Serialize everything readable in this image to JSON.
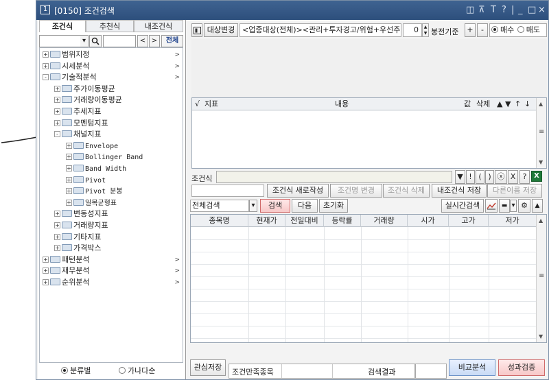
{
  "window": {
    "number": "1",
    "title": "[0150] 조건검색",
    "controls": [
      "◫",
      "⊼",
      "T",
      "?",
      "|",
      "_",
      "□",
      "×"
    ]
  },
  "left": {
    "tabs": [
      "조건식",
      "추천식",
      "내조건식"
    ],
    "search": {
      "value": "",
      "all_label": "전체",
      "prev": "<",
      "next": ">",
      "dropdown": "▾",
      "search_icon": "search-icon"
    },
    "tree": [
      {
        "label": "범위지정",
        "level": 0,
        "exp": "+",
        "arrow": ">"
      },
      {
        "label": "시세분석",
        "level": 0,
        "exp": "+",
        "arrow": ">"
      },
      {
        "label": "기술적분석",
        "level": 0,
        "exp": "-",
        "arrow": ">"
      },
      {
        "label": "주가이동평균",
        "level": 1,
        "exp": "+"
      },
      {
        "label": "거래량이동평균",
        "level": 1,
        "exp": "+"
      },
      {
        "label": "추세지표",
        "level": 1,
        "exp": "+"
      },
      {
        "label": "모멘텀지표",
        "level": 1,
        "exp": "+"
      },
      {
        "label": "채널지표",
        "level": 1,
        "exp": "-"
      },
      {
        "label": "Envelope",
        "level": 2,
        "exp": "+"
      },
      {
        "label": "Bollinger Band",
        "level": 2,
        "exp": "+"
      },
      {
        "label": "Band Width",
        "level": 2,
        "exp": "+"
      },
      {
        "label": "Pivot",
        "level": 2,
        "exp": "+"
      },
      {
        "label": "Pivot 분봉",
        "level": 2,
        "exp": "+"
      },
      {
        "label": "일목균형표",
        "level": 2,
        "exp": "+"
      },
      {
        "label": "변동성지표",
        "level": 1,
        "exp": "+"
      },
      {
        "label": "거래량지표",
        "level": 1,
        "exp": "+"
      },
      {
        "label": "기타지표",
        "level": 1,
        "exp": "+"
      },
      {
        "label": "가격박스",
        "level": 1,
        "exp": "+"
      },
      {
        "label": "패턴분석",
        "level": 0,
        "exp": "+",
        "arrow": ">"
      },
      {
        "label": "재무분석",
        "level": 0,
        "exp": "+",
        "arrow": ">"
      },
      {
        "label": "순위분석",
        "level": 0,
        "exp": "+",
        "arrow": ">"
      }
    ],
    "sort": {
      "by_category": "분류별",
      "by_alpha": "가나다순",
      "selected": "by_category"
    }
  },
  "toolbar": {
    "target_change": "대상변경",
    "target_desc": "<업종대상(전체)><관리+투자경고/위험+우선주",
    "candle_value": "0",
    "candle_basis": "봉전기준",
    "plus": "+",
    "minus": "-",
    "buy": "매수",
    "sell": "매도",
    "selected": "buy"
  },
  "conditions_table": {
    "check": "√",
    "headers": [
      "지표",
      "내용",
      "값",
      "삭제"
    ],
    "controls": [
      "▲",
      "▼",
      "↑",
      "↓"
    ]
  },
  "formula": {
    "label": "조건식",
    "value": "",
    "buttons": [
      "▼",
      "!",
      "(",
      ")",
      "ⓧ",
      "X",
      "?"
    ]
  },
  "condition_actions": {
    "name_value": "",
    "new": "조건식 새로작성",
    "rename": "조건명 변경",
    "delete": "조건식 삭제",
    "save_mine": "내조건식 저장",
    "save_as": "다른이름 저장"
  },
  "search_bar": {
    "scope": "전체검색",
    "search": "검색",
    "next": "다음",
    "reset": "초기화",
    "realtime": "실시간검색"
  },
  "results": {
    "headers": [
      "종목명",
      "현재가",
      "전일대비",
      "등락률",
      "거래량",
      "시가",
      "고가",
      "저가"
    ],
    "rows": []
  },
  "bottom": {
    "save_interest": "관심저장",
    "matched_label": "조건만족종목",
    "matched_value": "",
    "result_label": "검색결과",
    "result_value": "",
    "compare": "비교분석",
    "verify": "성과검증"
  },
  "annotation": {
    "color": "#222222"
  }
}
